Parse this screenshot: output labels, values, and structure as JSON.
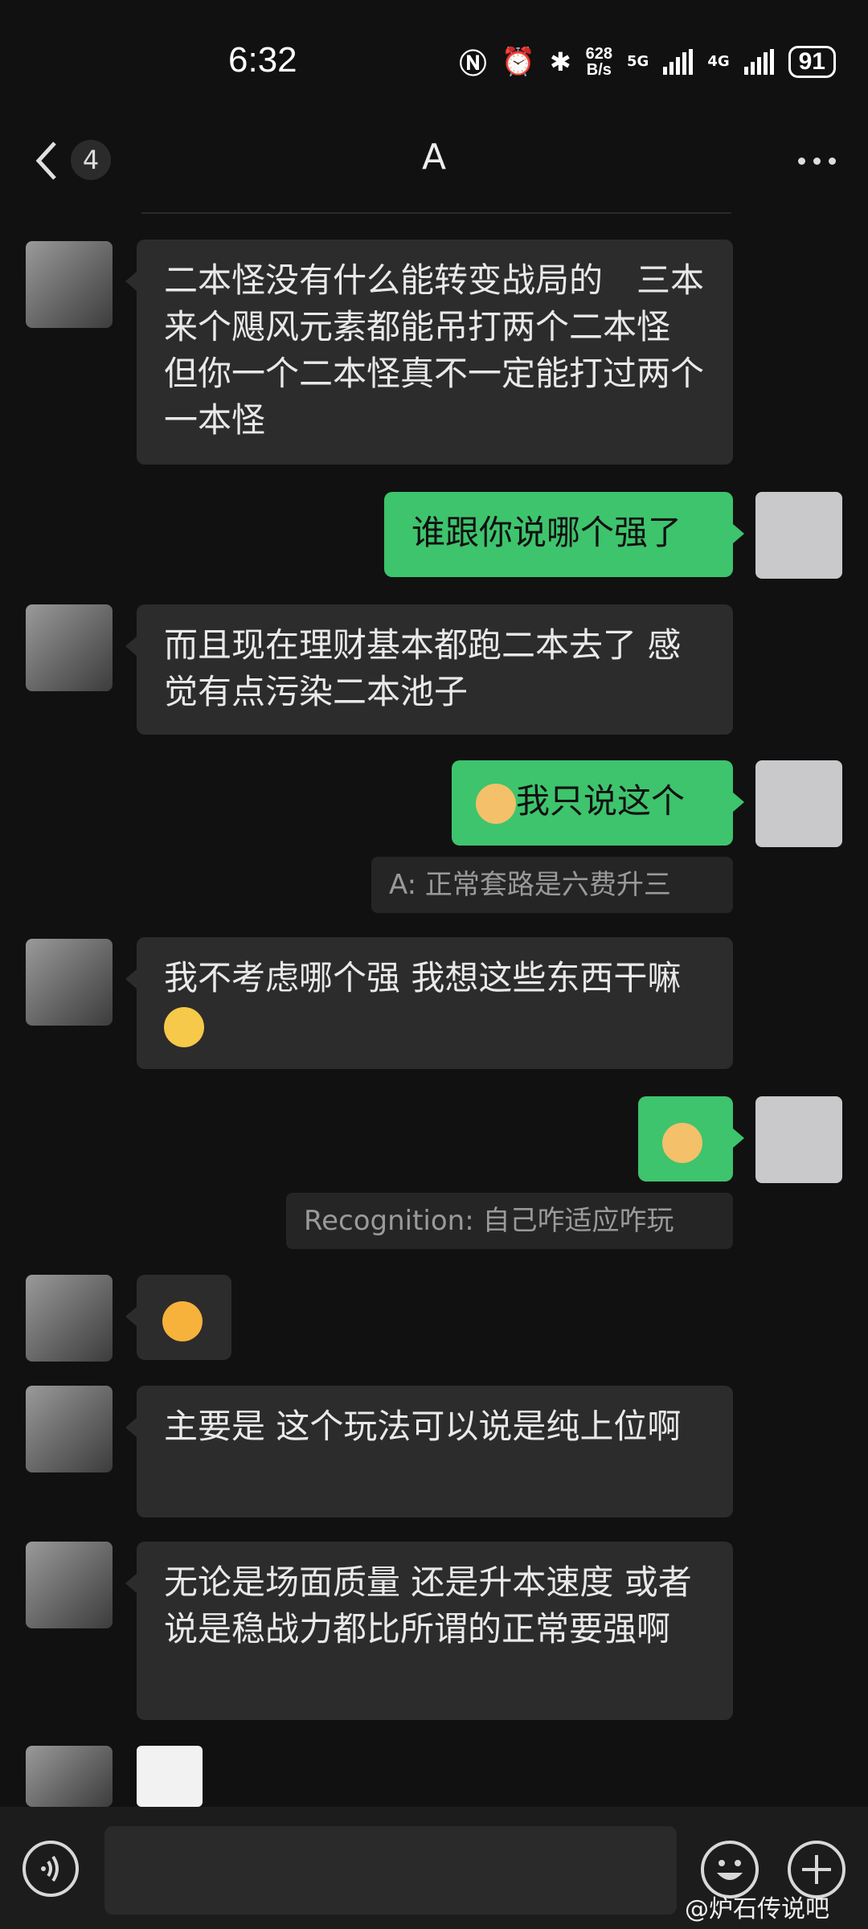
{
  "status_bar": {
    "time": "6:32",
    "net_speed_value": "628",
    "net_speed_unit": "B/s",
    "network_1": "5G",
    "network_2": "4G",
    "battery": "91"
  },
  "header": {
    "title": "A",
    "unread_count": "4"
  },
  "messages": {
    "m1": "二本怪没有什么能转变战局的　三本来个飓风元素都能吊打两个二本怪  但你一个二本怪真不一定能打过两个一本怪",
    "m2": "谁跟你说哪个强了",
    "m3": "而且现在理财基本都跑二本去了 感觉有点污染二本池子",
    "m4": "我只说这个",
    "q1": "A:  正常套路是六费升三",
    "m5": "我不考虑哪个强 我想这些东西干嘛",
    "q2": "Recognition:  自己咋适应咋玩",
    "m8": "主要是 这个玩法可以说是纯上位啊",
    "m9": "无论是场面质量  还是升本速度 或者说是稳战力都比所谓的正常要强啊"
  },
  "watermark": "@炉石传说吧",
  "colors": {
    "background": "#111111",
    "bubble_other": "#2c2c2c",
    "bubble_me": "#3ec46d"
  }
}
